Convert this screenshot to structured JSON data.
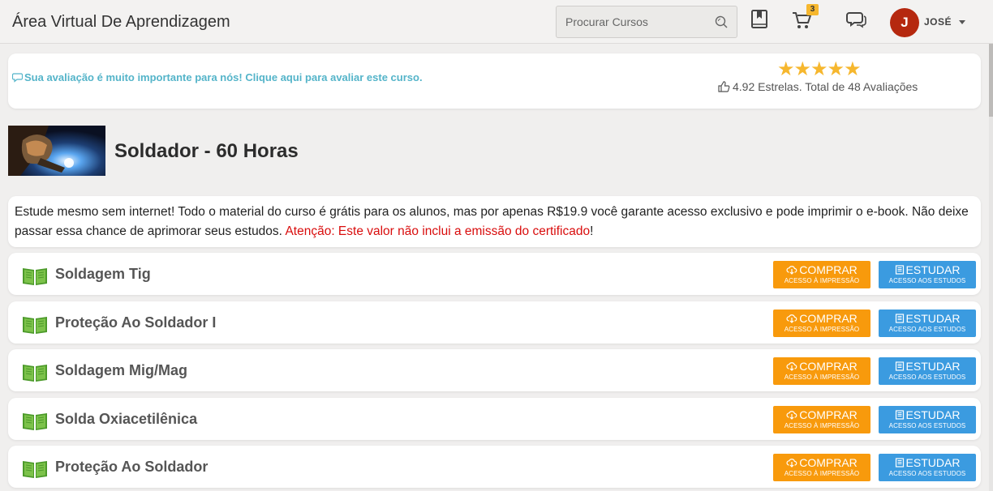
{
  "header": {
    "title": "Área Virtual De Aprendizagem",
    "search_placeholder": "Procurar Cursos",
    "cart_count": "3",
    "user_initial": "J",
    "user_name": "JOSÉ",
    "icons": [
      "library-book-icon",
      "shopping-cart-icon",
      "chat-icon",
      "search-icon"
    ]
  },
  "rating": {
    "prompt": "Sua avaliação é muito importante para nós! Clique aqui para avaliar este curso.",
    "stars": "★★★★★",
    "summary": "4.92 Estrelas. Total de 48 Avaliações"
  },
  "course": {
    "title": "Soldador - 60 Horas"
  },
  "info": {
    "text": "Estude mesmo sem internet! Todo o material do curso é grátis para os alunos, mas por apenas R$19.9 você garante acesso exclusivo e pode imprimir o e-book. Não deixe passar essa chance de aprimorar seus estudos. ",
    "warning": "Atenção: Este valor não inclui a emissão do certificado",
    "end": "!"
  },
  "buttons": {
    "buy_label": "COMPRAR",
    "buy_sub": "ACESSO À IMPRESSÃO",
    "study_label": "ESTUDAR",
    "study_sub": "ACESSO AOS ESTUDOS"
  },
  "modules": [
    {
      "title": "Soldagem Tig"
    },
    {
      "title": "Proteção Ao Soldador I"
    },
    {
      "title": "Soldagem Mig/Mag"
    },
    {
      "title": "Solda Oxiacetilênica"
    },
    {
      "title": "Proteção Ao Soldador"
    }
  ],
  "colors": {
    "buy": "#f89a0c",
    "study": "#3b9be0",
    "rate_link": "#54b4c9",
    "warning": "#d90d0d",
    "avatar": "#b5280f"
  }
}
